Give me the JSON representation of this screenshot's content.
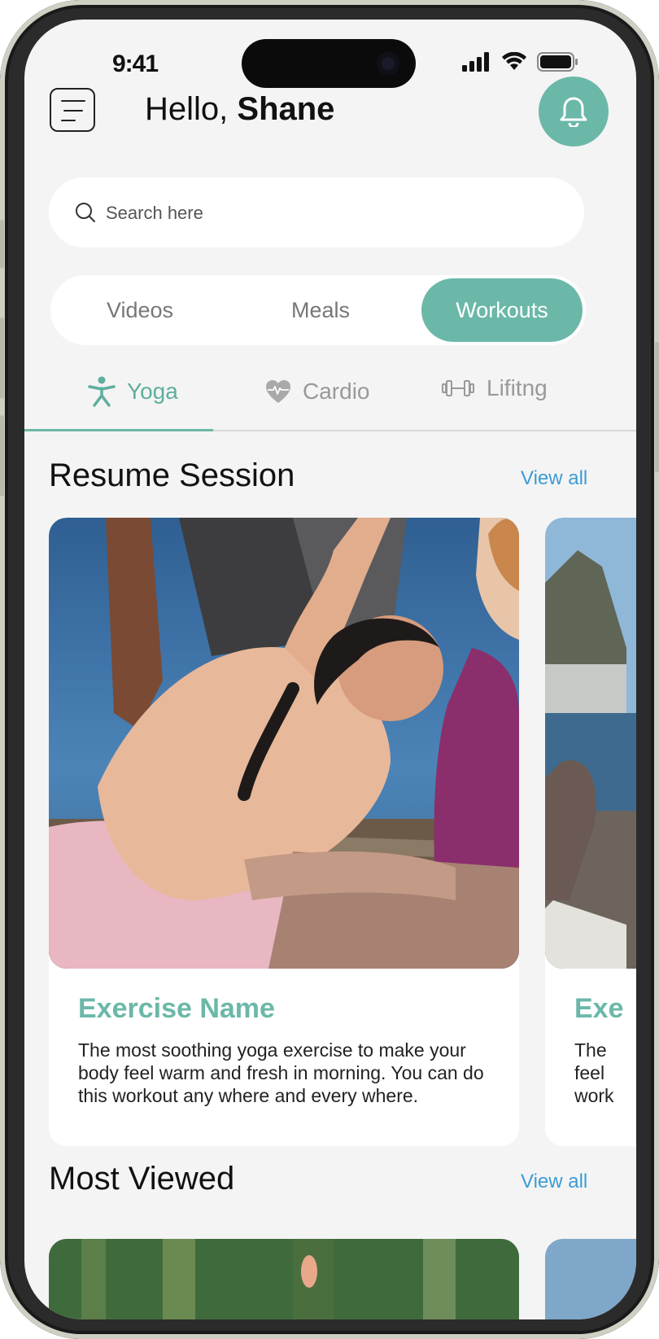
{
  "status_bar": {
    "time": "9:41"
  },
  "header": {
    "greeting_prefix": "Hello, ",
    "user_name": "Shane"
  },
  "search": {
    "placeholder": "Search here"
  },
  "segments": [
    {
      "label": "Videos",
      "active": false
    },
    {
      "label": "Meals",
      "active": false
    },
    {
      "label": "Workouts",
      "active": true
    }
  ],
  "categories": [
    {
      "label": "Yoga",
      "icon": "yoga-person-icon",
      "active": true
    },
    {
      "label": "Cardio",
      "icon": "heart-pulse-icon",
      "active": false
    },
    {
      "label": "Lifitng",
      "icon": "dumbbell-icon",
      "active": false
    }
  ],
  "resume_section": {
    "title": "Resume Session",
    "view_all": "View all",
    "cards": [
      {
        "title": "Exercise Name",
        "description": "The most soothing yoga exercise to make your body feel warm and fresh in morning. You can do this workout any where and every where."
      },
      {
        "title": "Exe",
        "description": "The\nfeel\nwork"
      }
    ]
  },
  "most_viewed_section": {
    "title": "Most Viewed",
    "view_all": "View all"
  },
  "colors": {
    "accent": "#6bb8a8",
    "link": "#3c9cd4",
    "background": "#f4f4f4"
  }
}
